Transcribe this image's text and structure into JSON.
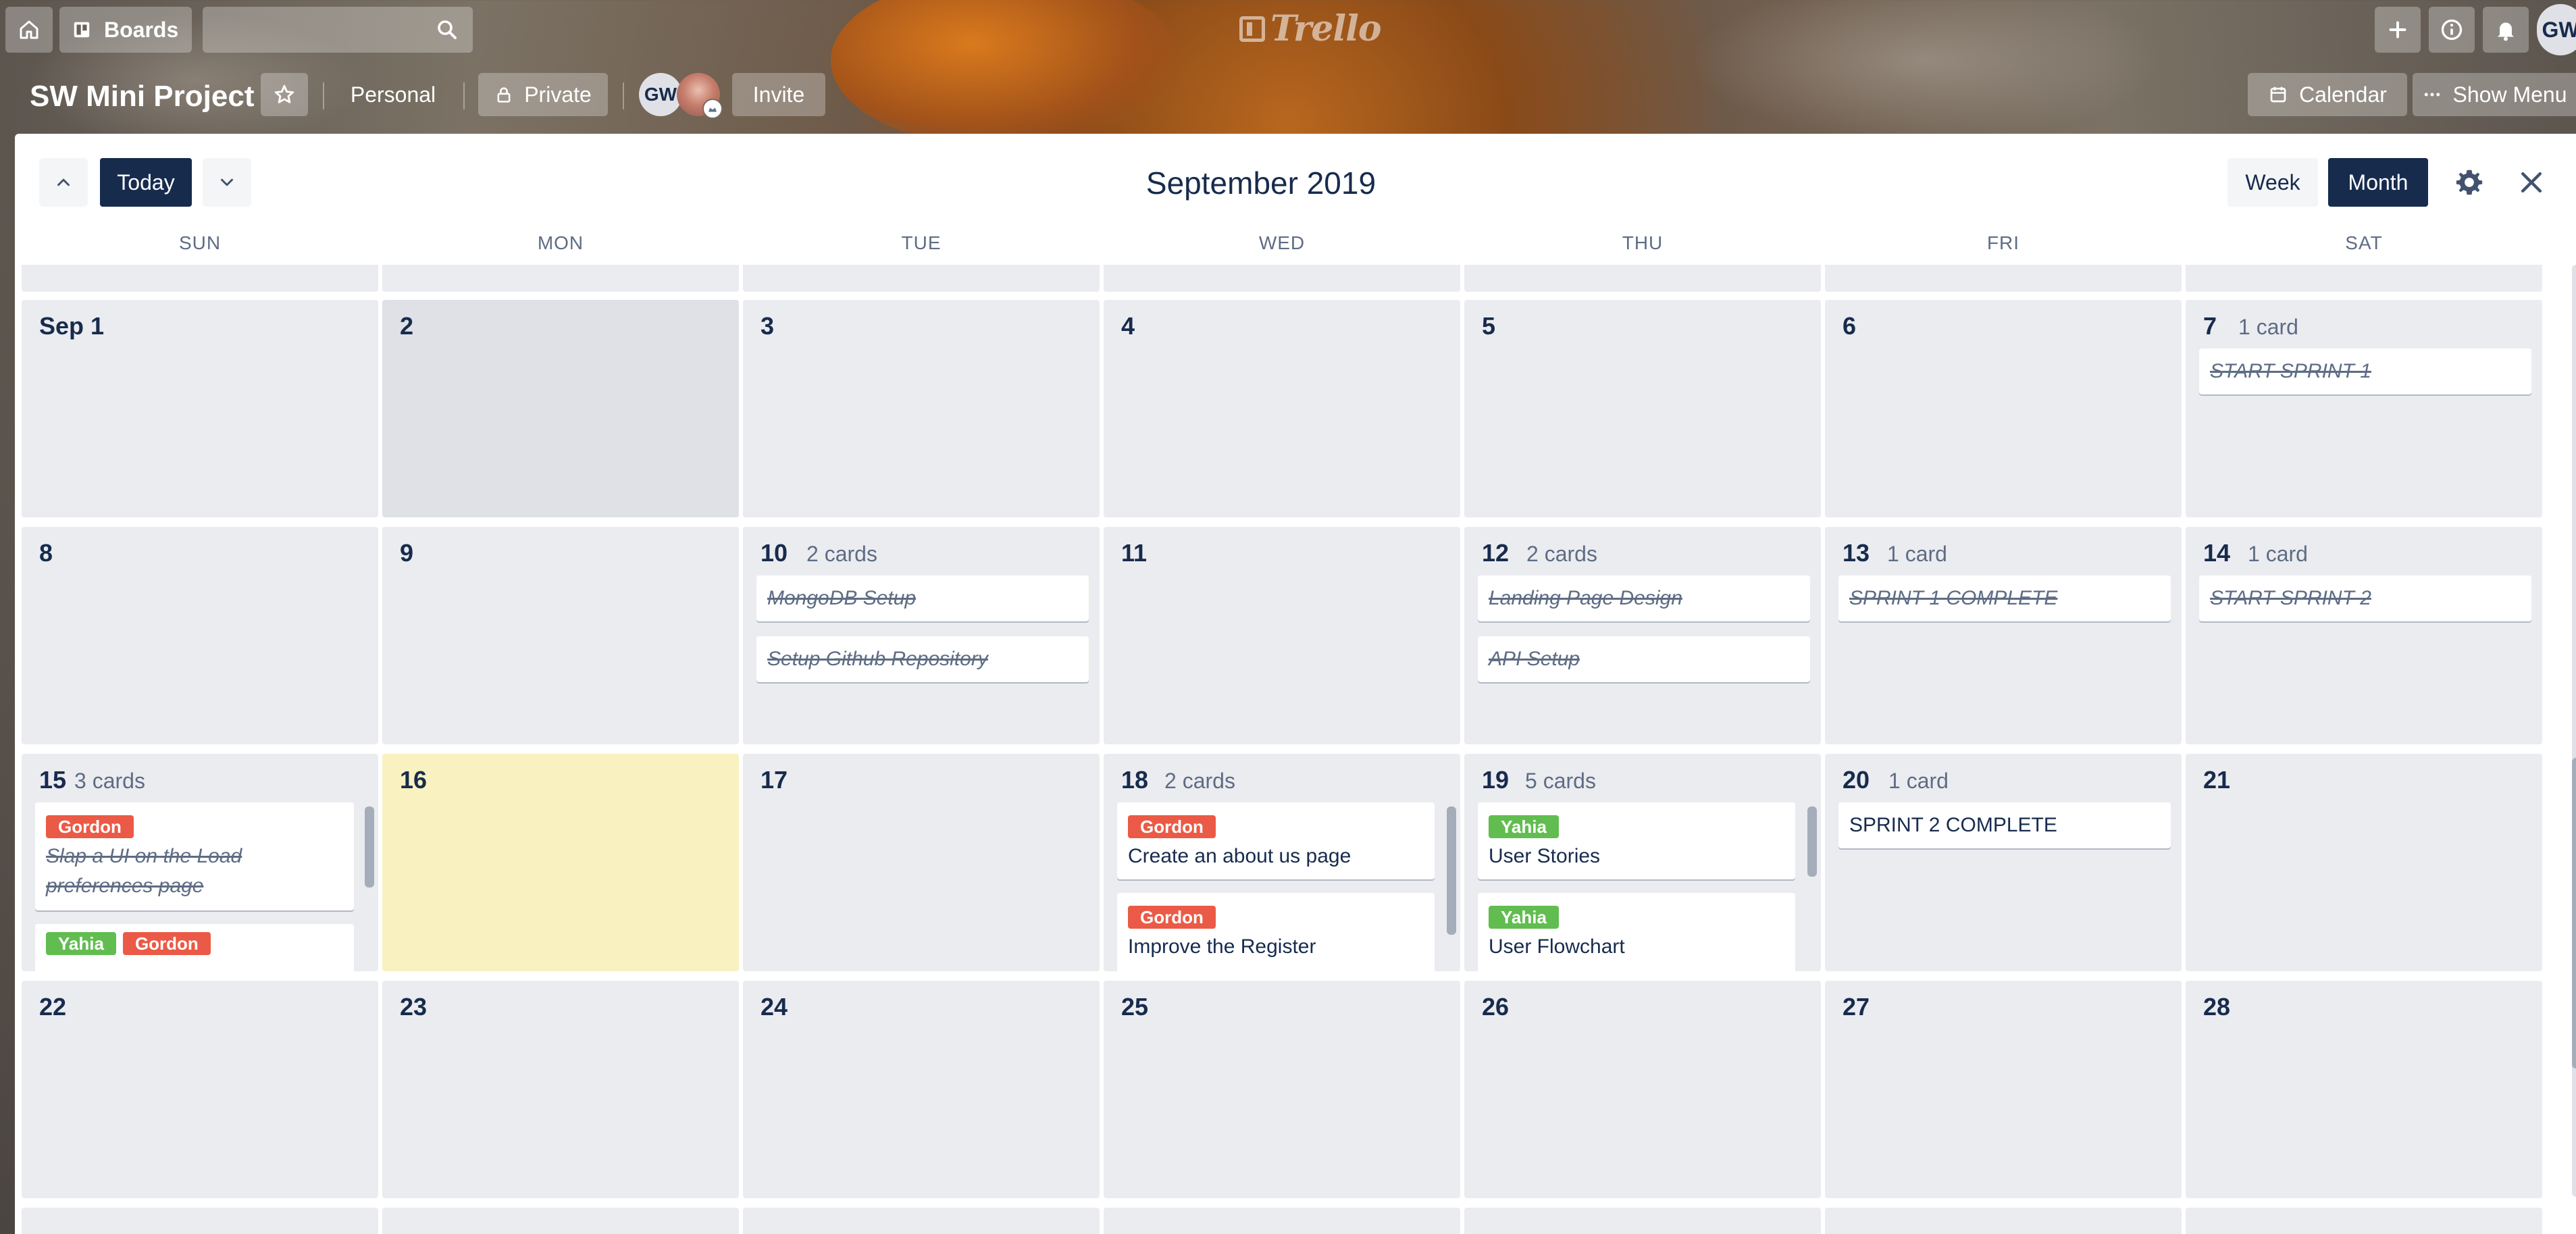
{
  "topbar": {
    "boards_label": "Boards",
    "search_placeholder": "",
    "logo_text": "Trello",
    "avatar_initials": "GW"
  },
  "board": {
    "title": "SW Mini Project",
    "team_label": "Personal",
    "visibility_label": "Private",
    "member_initials": "GW",
    "invite_label": "Invite",
    "calendar_label": "Calendar",
    "show_menu_label": "Show Menu"
  },
  "calendar": {
    "today_label": "Today",
    "title": "September 2019",
    "week_label": "Week",
    "month_label": "Month",
    "days_of_week": [
      "SUN",
      "MON",
      "TUE",
      "WED",
      "THU",
      "FRI",
      "SAT"
    ],
    "weeks": [
      [
        {
          "day": "Sep 1"
        },
        {
          "day": "2"
        },
        {
          "day": "3"
        },
        {
          "day": "4"
        },
        {
          "day": "5"
        },
        {
          "day": "6"
        },
        {
          "day": "7",
          "count": "1 card",
          "cards": [
            {
              "title": "START SPRINT 1",
              "done": true
            }
          ]
        }
      ],
      [
        {
          "day": "8"
        },
        {
          "day": "9"
        },
        {
          "day": "10",
          "count": "2 cards",
          "cards": [
            {
              "title": "MongoDB Setup",
              "done": true
            },
            {
              "title": "Setup Github Repository",
              "done": true
            }
          ]
        },
        {
          "day": "11"
        },
        {
          "day": "12",
          "count": "2 cards",
          "cards": [
            {
              "title": "Landing Page Design",
              "done": true
            },
            {
              "title": "API Setup",
              "done": true
            }
          ]
        },
        {
          "day": "13",
          "count": "1 card",
          "cards": [
            {
              "title": "SPRINT 1 COMPLETE",
              "done": true
            }
          ]
        },
        {
          "day": "14",
          "count": "1 card",
          "cards": [
            {
              "title": "START SPRINT 2",
              "done": true
            }
          ]
        }
      ],
      [
        {
          "day": "15",
          "count": "3 cards",
          "cards": [
            {
              "labels": [
                "Gordon"
              ],
              "title": "Slap a UI on the Load preferences page",
              "done": true
            },
            {
              "labels": [
                "Yahia",
                "Gordon"
              ],
              "title": "",
              "done": false
            }
          ]
        },
        {
          "day": "16"
        },
        {
          "day": "17"
        },
        {
          "day": "18",
          "count": "2 cards",
          "cards": [
            {
              "labels": [
                "Gordon"
              ],
              "title": "Create an about us page",
              "done": false
            },
            {
              "labels": [
                "Gordon"
              ],
              "title": "Improve the Register",
              "done": false
            }
          ]
        },
        {
          "day": "19",
          "count": "5 cards",
          "cards": [
            {
              "labels": [
                "Yahia"
              ],
              "title": "User Stories",
              "done": false
            },
            {
              "labels": [
                "Yahia"
              ],
              "title": "User Flowchart",
              "done": false
            }
          ]
        },
        {
          "day": "20",
          "count": "1 card",
          "cards": [
            {
              "title": "SPRINT 2 COMPLETE",
              "done": false
            }
          ]
        },
        {
          "day": "21"
        }
      ],
      [
        {
          "day": "22"
        },
        {
          "day": "23"
        },
        {
          "day": "24"
        },
        {
          "day": "25"
        },
        {
          "day": "26"
        },
        {
          "day": "27"
        },
        {
          "day": "28"
        }
      ]
    ]
  },
  "colors": {
    "label_red": "#eb5a46",
    "label_green": "#61bd4f",
    "navy": "#172b4d",
    "today_cell": "#f9f1c0"
  }
}
